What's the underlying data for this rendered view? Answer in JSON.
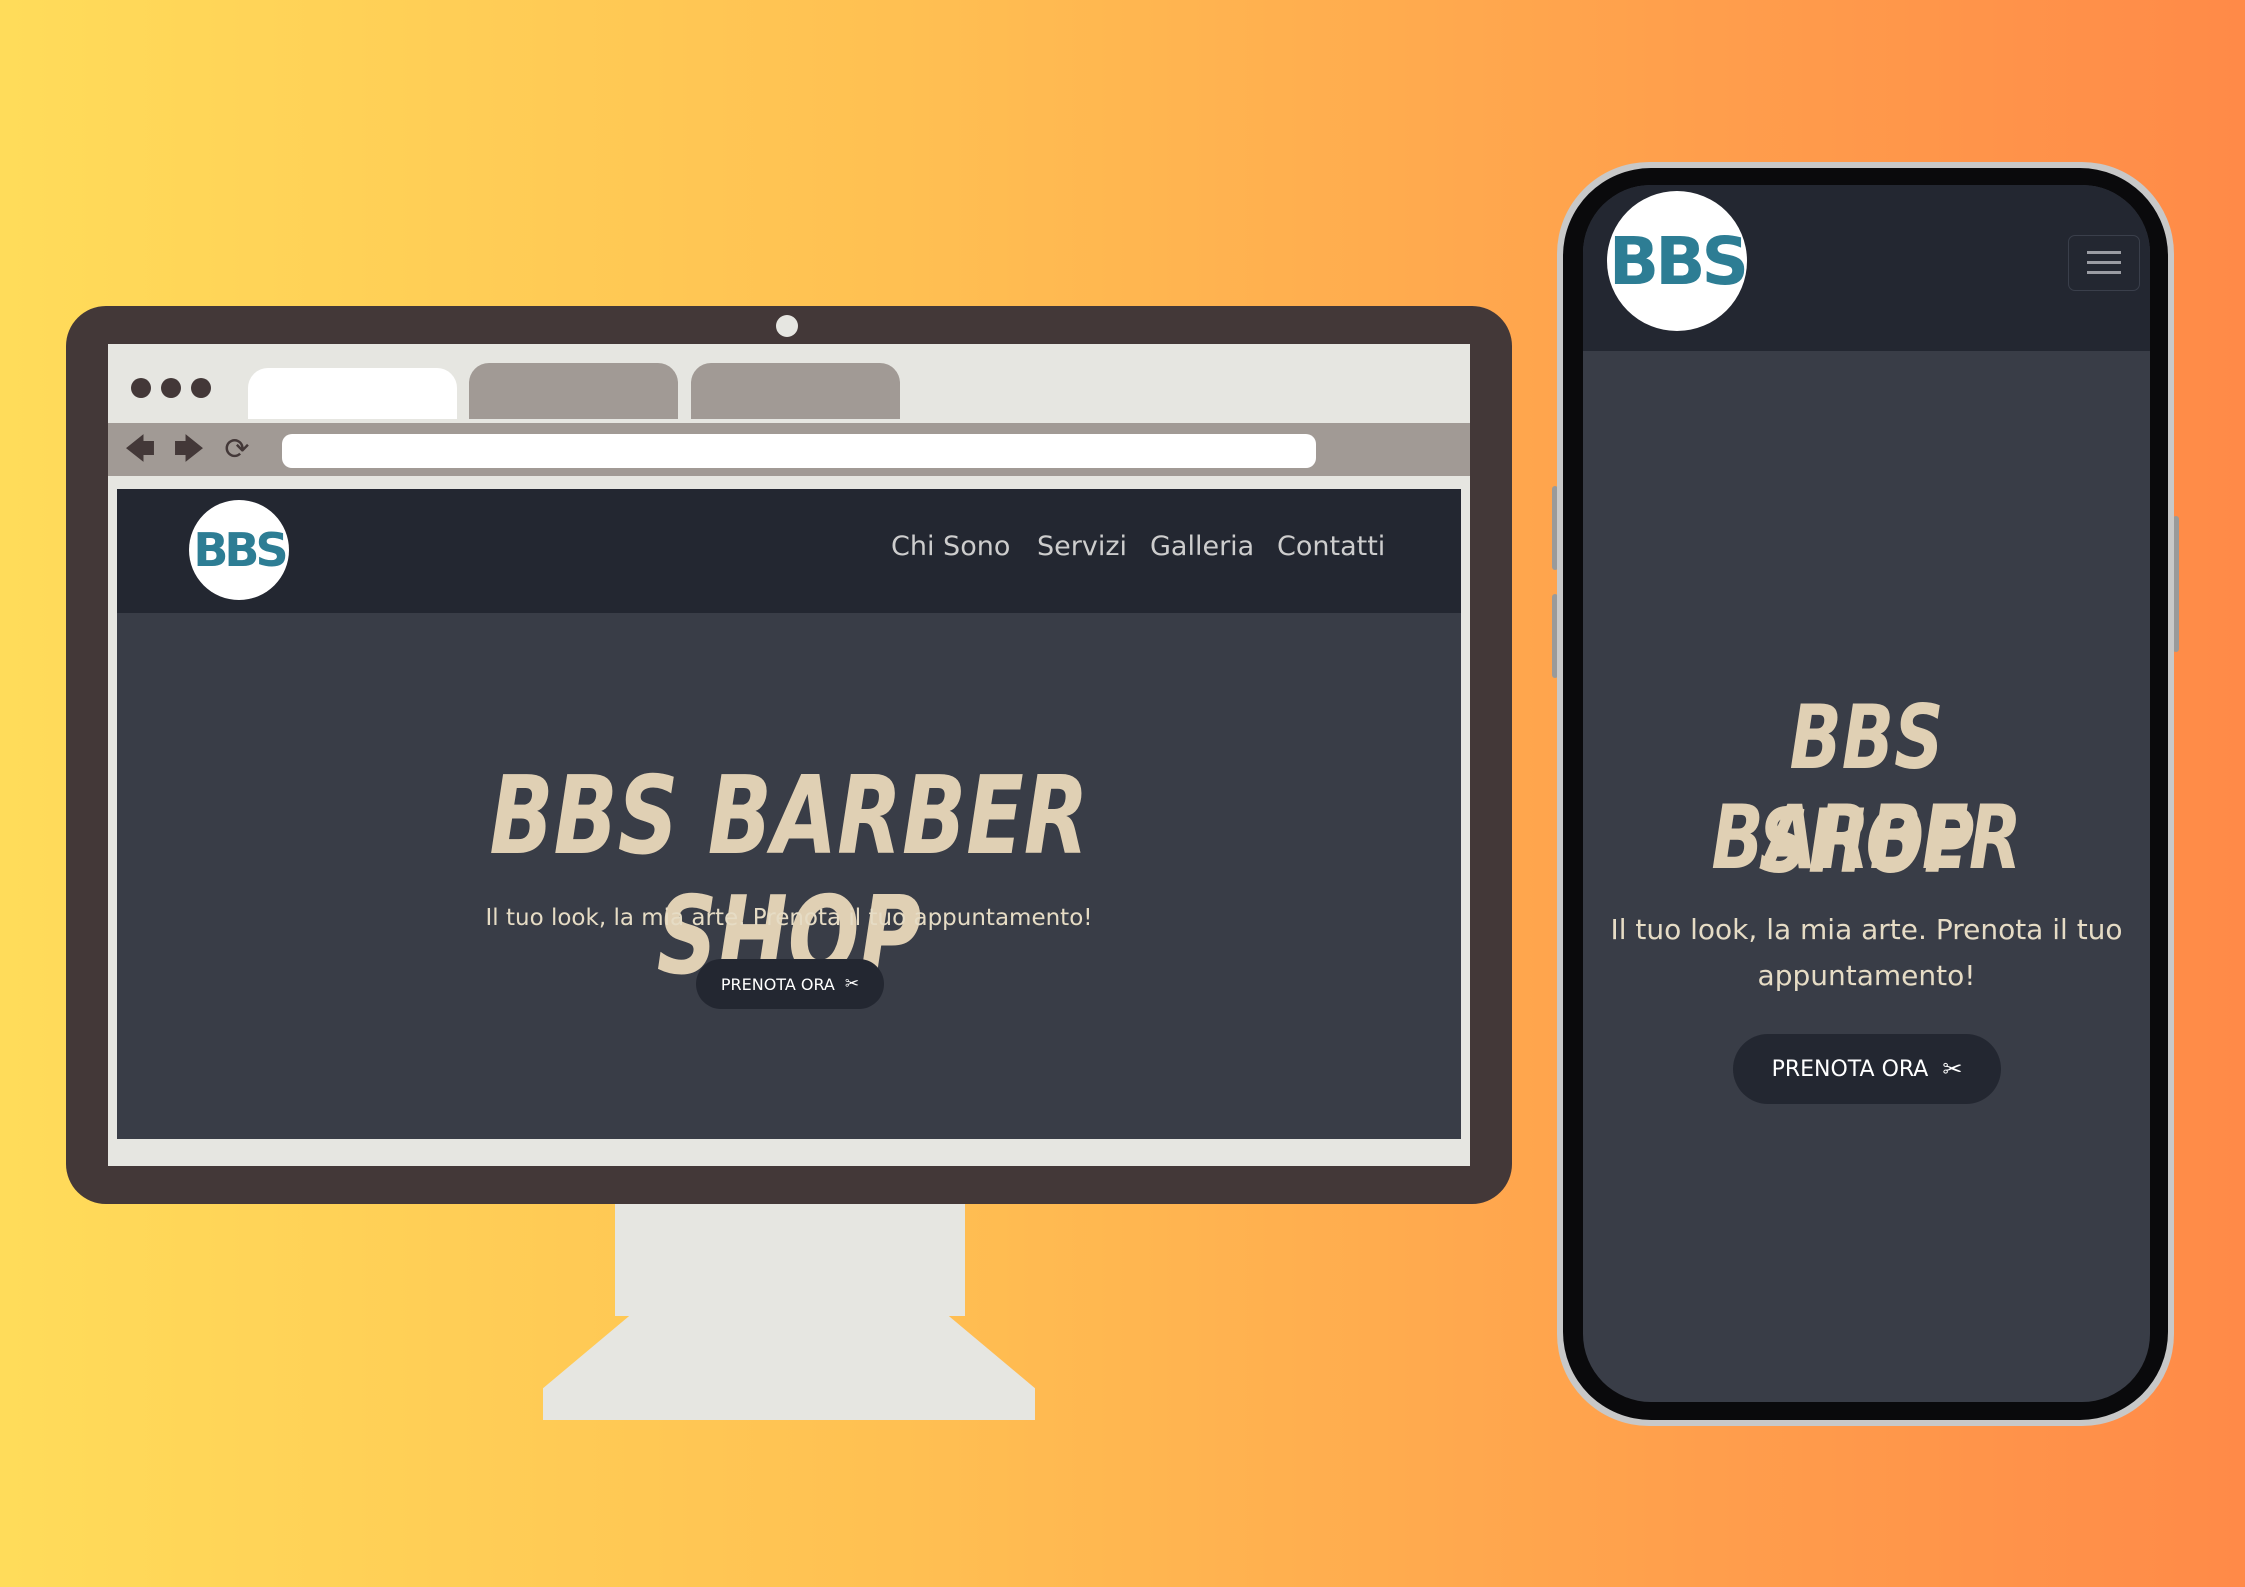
{
  "desktop": {
    "site": {
      "logo_text": "BBS",
      "nav": [
        {
          "label": "Chi Sono"
        },
        {
          "label": "Servizi"
        },
        {
          "label": "Galleria"
        },
        {
          "label": "Contatti"
        }
      ],
      "hero": {
        "title": "BBS BARBER SHOP",
        "subtitle": "Il tuo look, la mia arte. Prenota il tuo appuntamento!",
        "cta_label": "PRENOTA ORA"
      }
    }
  },
  "phone": {
    "logo_text": "BBS",
    "hero": {
      "title_line1": "BBS BARBER",
      "title_line2": "SHOP",
      "subtitle_line1": "Il tuo look, la mia arte. Prenota il tuo",
      "subtitle_line2": "appuntamento!",
      "cta_label": "PRENOTA ORA"
    }
  },
  "icons": {
    "back": "arrow-left-icon",
    "forward": "arrow-right-icon",
    "reload": "reload-icon",
    "cta": "scissors-icon",
    "menu": "hamburger-menu-icon"
  },
  "colors": {
    "header_bg": "#232731",
    "hero_bg": "#393d47",
    "title": "#e0d0b4",
    "logo_accent": "#2d7d94"
  }
}
